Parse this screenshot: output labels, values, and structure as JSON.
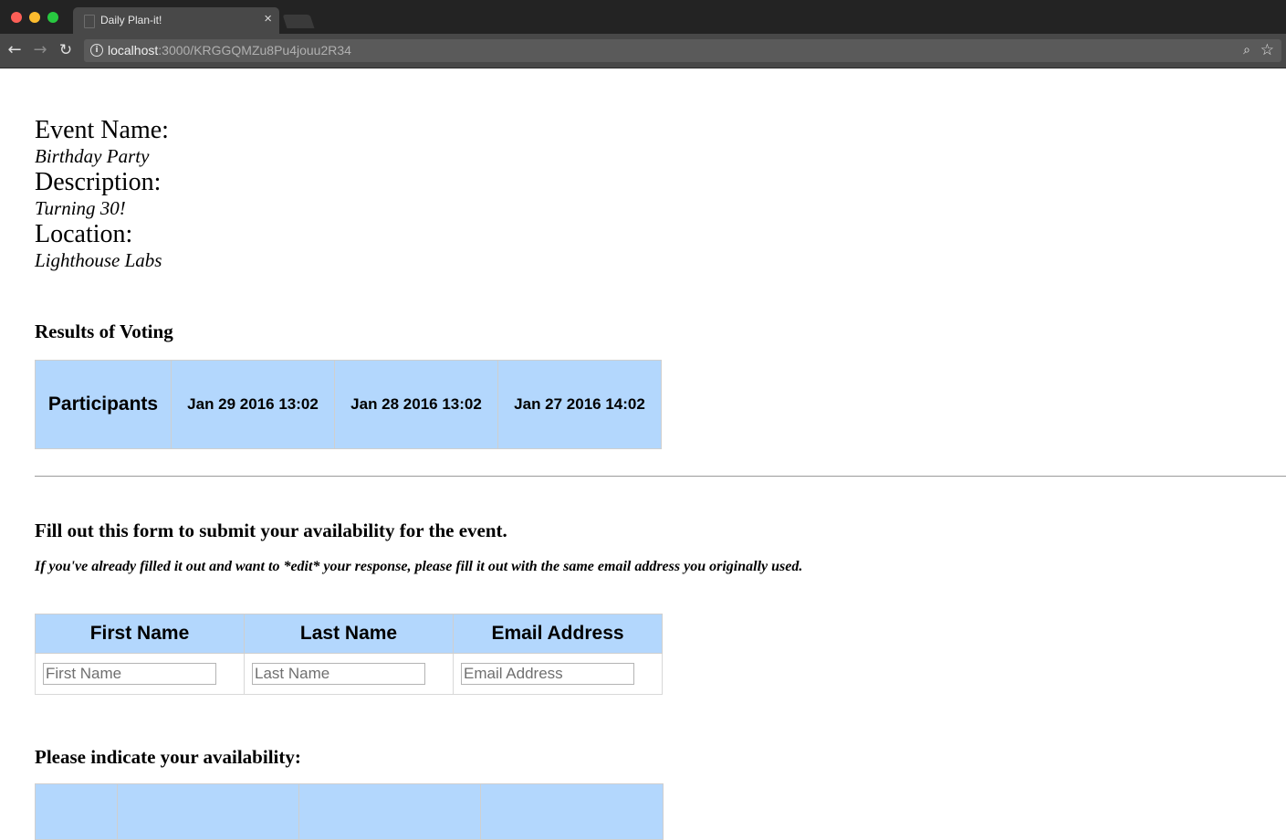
{
  "browser": {
    "tab_title": "Daily Plan-it!",
    "tab_close": "×",
    "url_host": "localhost",
    "url_path": ":3000/KRGGQMZu8Pu4jouu2R34"
  },
  "icons": {
    "back": "←",
    "forward": "→",
    "reload": "↻",
    "info": "i",
    "zoom": "⌕",
    "star": "☆"
  },
  "event": {
    "name_label": "Event Name:",
    "name": "Birthday Party",
    "description_label": "Description:",
    "description": "Turning 30!",
    "location_label": "Location:",
    "location": "Lighthouse Labs"
  },
  "results": {
    "heading": "Results of Voting",
    "participants_header": "Participants",
    "dates": [
      "Jan 29 2016 13:02",
      "Jan 28 2016 13:02",
      "Jan 27 2016 14:02"
    ]
  },
  "form": {
    "heading": "Fill out this form to submit your availability for the event.",
    "note": "If you've already filled it out and want to *edit* your response, please fill it out with the same email address you originally used.",
    "columns": [
      "First Name",
      "Last Name",
      "Email Address"
    ],
    "placeholders": {
      "first_name": "First Name",
      "last_name": "Last Name",
      "email": "Email Address"
    }
  },
  "availability": {
    "heading": "Please indicate your availability:"
  }
}
